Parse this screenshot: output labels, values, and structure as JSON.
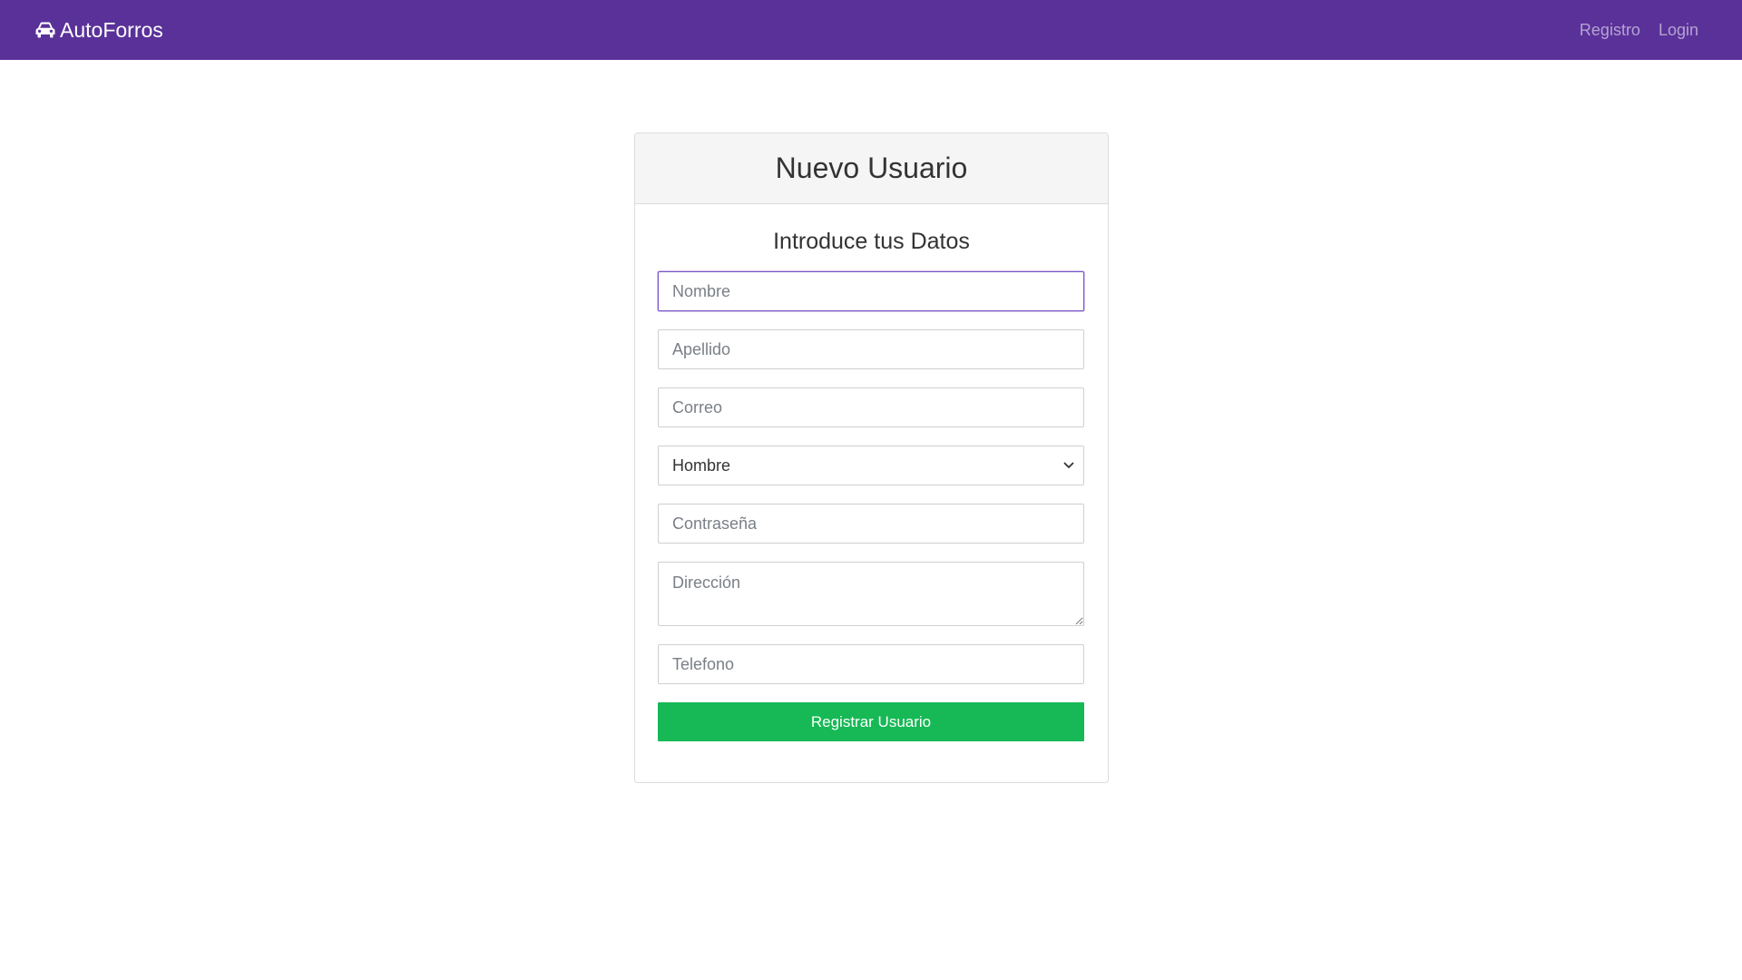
{
  "navbar": {
    "brand": "AutoForros",
    "brand_icon": "car-icon",
    "links": [
      "Registro",
      "Login"
    ],
    "background": "#5a3199"
  },
  "card": {
    "title": "Nuevo Usuario",
    "subtitle": "Introduce tus Datos"
  },
  "form": {
    "nombre_placeholder": "Nombre",
    "apellido_placeholder": "Apellido",
    "correo_placeholder": "Correo",
    "genero_selected": "Hombre",
    "contrasena_placeholder": "Contraseña",
    "direccion_placeholder": "Dirección",
    "telefono_placeholder": "Telefono",
    "submit_label": "Registrar Usuario",
    "submit_color": "#16b955"
  }
}
